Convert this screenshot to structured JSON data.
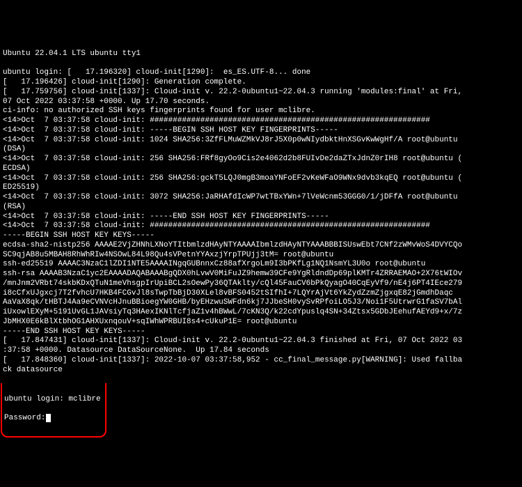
{
  "header": "Ubuntu 22.04.1 LTS ubuntu tty1",
  "lines": [
    "",
    "ubuntu login: [   17.196320] cloud-init[1290]:  es_ES.UTF-8... done",
    "[   17.196426] cloud-init[1290]: Generation complete.",
    "[   17.759756] cloud-init[1337]: Cloud-init v. 22.2-0ubuntu1~22.04.3 running 'modules:final' at Fri,",
    "07 Oct 2022 03:37:58 +0000. Up 17.70 seconds.",
    "ci-info: no authorized SSH keys fingerprints found for user mclibre.",
    "<14>Oct  7 03:37:58 cloud-init: #############################################################",
    "<14>Oct  7 03:37:58 cloud-init: -----BEGIN SSH HOST KEY FINGERPRINTS-----",
    "<14>Oct  7 03:37:58 cloud-init: 1024 SHA256:3ZfFLMuWZMkVJ8rJ5X0p0wNIydbktHnXSGvKwWgHf/A root@ubuntu",
    "(DSA)",
    "<14>Oct  7 03:37:58 cloud-init: 256 SHA256:FRf8gyOo9Cis2e4062d2b8FUIvDe2daZTxJdnZ0rIH8 root@ubuntu (",
    "ECDSA)",
    "<14>Oct  7 03:37:58 cloud-init: 256 SHA256:gckT5LQJ0mgB3moaYNFoEF2vKeWFaO9WNx9dvb3kqEQ root@ubuntu (",
    "ED25519)",
    "<14>Oct  7 03:37:58 cloud-init: 3072 SHA256:JaRHAfdIcWP7wtTBxYWn+7lVeWcnm53GGG0/1/jDFfA root@ubuntu",
    "(RSA)",
    "<14>Oct  7 03:37:58 cloud-init: -----END SSH HOST KEY FINGERPRINTS-----",
    "<14>Oct  7 03:37:58 cloud-init: #############################################################",
    "-----BEGIN SSH HOST KEY KEYS-----",
    "ecdsa-sha2-nistp256 AAAAE2VjZHNhLXNoYTItbmlzdHAyNTYAAAAIbmlzdHAyNTYAAABBBISUswEbt7CNf2zWMvWoS4DVYCQo",
    "SC9qjAB8u5MBAH8RhWhRIw4NSOwL84L98Qu4sVPetnYYAxzjYrpTPUjj3tM= root@ubuntu",
    "ssh-ed25519 AAAAC3NzaC1lZDI1NTE5AAAAINgqGUBnnxCz88afXrgoLm9I3bPKfLg1NQ1NsmYL3U0o root@ubuntu",
    "ssh-rsa AAAAB3NzaC1yc2EAAAADAQABAAABgQDX0hLvwV0MiFuJZ9hemw39CFe9YgRldndDp69plKMTr4ZRRAEMAO+2X76tWIOv",
    "/mnJnm2VRbt74skbKDxQTuN1meVhsgpIrUpiBCL2sOewPy36QTAklty/cQl45FauCV6bPkQyagO40CqEyVf9/nE4j6PT4IEce279",
    "i8cCfxUJgxcj7T2fvhcU7HKB4FCGvJl8sTwpTbBjD30XLel8vBFS0452tSIfhI+7LQYrAjVt6YkZydZzmZjgxqE82jGmdhDaqc",
    "AaVaX8qk/tHBTJ4Aa9eCVNVcHJnuBBioegYW0GHB/byEHzwuSWFdn6kj7JJbeSH0vySvRPfoiLO5J3/Noi1F5UtrwrG1faSV7bAl",
    "iUxowlEXyM+5191UvGL1JAVsiyTq3HAexIKNlTcfjaZ1v4hBWwL/7cKN3Q/k22cdYpuslq4SN+34Ztsx5GDbJEehufAEYd9+x/7z",
    "JbMHX0E6kBlXtbhOG1AHXUxnqouV+sqIWhWPRBUI8s4+cUkuP1E= root@ubuntu",
    "-----END SSH HOST KEY KEYS-----",
    "[   17.847431] cloud-init[1337]: Cloud-init v. 22.2-0ubuntu1~22.04.3 finished at Fri, 07 Oct 2022 03",
    ":37:58 +0000. Datasource DataSourceNone.  Up 17.84 seconds",
    "[   17.848360] cloud-init[1337]: 2022-10-07 03:37:58,952 - cc_final_message.py[WARNING]: Used fallba",
    "ck datasource"
  ],
  "login": {
    "prompt": "ubuntu login: ",
    "username": "mclibre",
    "password_label": "Password:"
  }
}
